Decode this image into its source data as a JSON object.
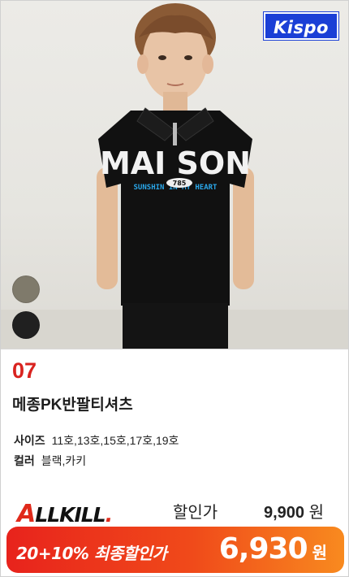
{
  "brand": {
    "logo_text": "Kispo",
    "logo_color": "#1b3fd6"
  },
  "product": {
    "rank": "07",
    "name": "메종PK반팔티셔츠",
    "shirt_print_main": "MAI SON",
    "shirt_print_sub": "SUNSHIN IN MY HEART",
    "shirt_badge": "785",
    "color_swatches": [
      {
        "name": "khaki",
        "hex": "#7f7a6b"
      },
      {
        "name": "black",
        "hex": "#202020"
      }
    ]
  },
  "specs": {
    "size_label": "사이즈",
    "size_value": "11호,13호,15호,17호,19호",
    "color_label": "컬러",
    "color_value": "블랙,카키"
  },
  "promo": {
    "allkill_a": "A",
    "allkill_rest": "LLKILL",
    "allkill_dot": ".",
    "discount_label": "할인가",
    "discount_price": "9,900",
    "currency": "원",
    "final_label": "20+10% 최종할인가",
    "final_price": "6,930",
    "final_currency": "원",
    "accent_red": "#e8231c",
    "accent_orange": "#f88a1f"
  }
}
